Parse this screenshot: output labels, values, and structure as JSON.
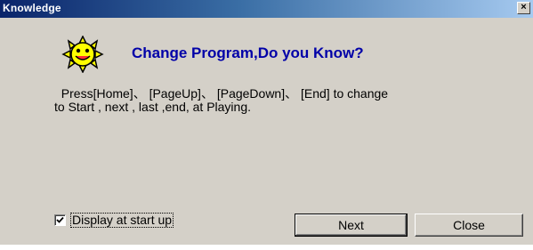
{
  "window": {
    "title": "Knowledge",
    "close_glyph": "×"
  },
  "icons": {
    "header": "smiling-sun-icon",
    "close": "close-icon",
    "check": "checkmark-icon"
  },
  "content": {
    "headline": "Change Program,Do you Know?",
    "message": "  Press[Home]、 [PageUp]、 [PageDown]、 [End] to change\nto Start , next , last ,end, at Playing."
  },
  "footer": {
    "checkbox_label": "Display at start up",
    "checkbox_checked": true,
    "next_label": "Next",
    "close_label": "Close"
  },
  "colors": {
    "headline": "#0000a8",
    "title_start": "#0a246a",
    "title_end": "#a6caf0",
    "face": "#d4d0c8",
    "sun": "#ffff00"
  }
}
